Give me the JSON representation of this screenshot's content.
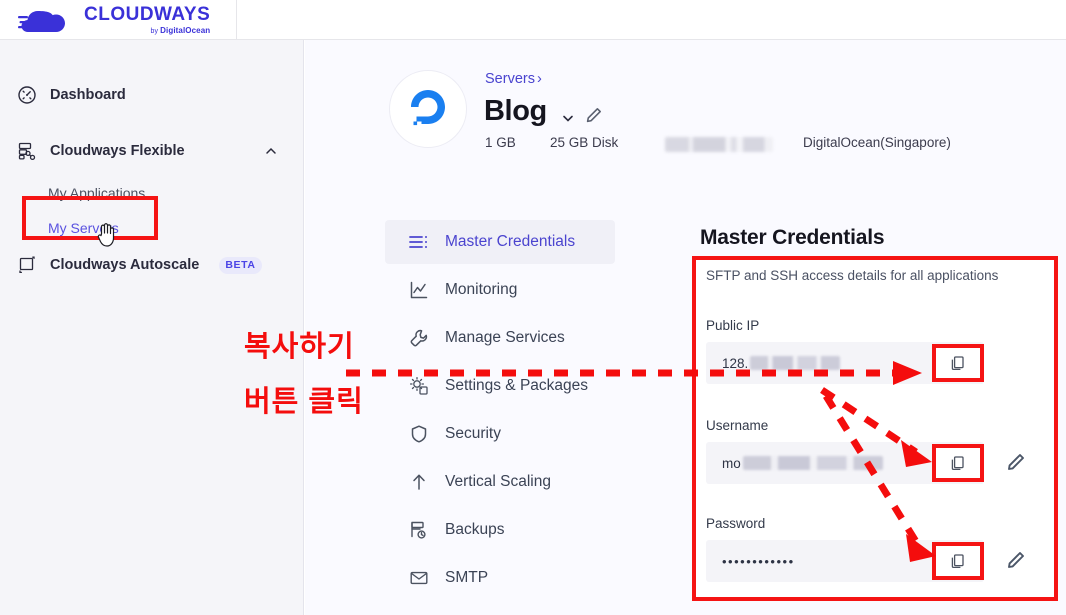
{
  "brand": {
    "name": "CLOUDWAYS",
    "byline_prefix": "by ",
    "byline": "DigitalOcean",
    "accent": "#3a31d8"
  },
  "sidebar": {
    "items": [
      {
        "label": "Dashboard",
        "icon": "speedometer-icon",
        "type": "item"
      },
      {
        "label": "Cloudways Flexible",
        "icon": "server-stack-icon",
        "type": "item",
        "expanded": true
      },
      {
        "label": "My Applications",
        "icon": "",
        "type": "sub"
      },
      {
        "label": "My Servers",
        "icon": "",
        "type": "sub",
        "selected": true
      },
      {
        "label": "Cloudways Autoscale",
        "icon": "autoscale-icon",
        "type": "item",
        "badge": "BETA"
      }
    ]
  },
  "header": {
    "breadcrumb": "Servers",
    "breadcrumb_sep": "›",
    "title": "Blog",
    "provider_logo": "digitalocean-icon",
    "meta": {
      "ram": "1 GB",
      "disk": "25 GB Disk",
      "ip_masked": "",
      "provider": "DigitalOcean(Singapore)"
    }
  },
  "server_nav": {
    "items": [
      {
        "label": "Master Credentials",
        "icon": "list-icon",
        "active": true
      },
      {
        "label": "Monitoring",
        "icon": "chart-line-icon",
        "active": false
      },
      {
        "label": "Manage Services",
        "icon": "wrench-icon",
        "active": false
      },
      {
        "label": "Settings & Packages",
        "icon": "gear-puzzle-icon",
        "active": false
      },
      {
        "label": "Security",
        "icon": "shield-icon",
        "active": false
      },
      {
        "label": "Vertical Scaling",
        "icon": "arrow-up-icon",
        "active": false
      },
      {
        "label": "Backups",
        "icon": "backup-icon",
        "active": false
      },
      {
        "label": "SMTP",
        "icon": "envelope-icon",
        "active": false
      }
    ]
  },
  "credentials": {
    "title": "Master Credentials",
    "subtitle": "SFTP and SSH access details for all applications",
    "fields": [
      {
        "label": "Public IP",
        "value": "128.",
        "masked": true,
        "has_edit": false,
        "copy_icon": "copy-icon"
      },
      {
        "label": "Username",
        "value": "mo",
        "masked": true,
        "has_edit": true,
        "copy_icon": "copy-icon",
        "edit_icon": "pencil-icon"
      },
      {
        "label": "Password",
        "value": "••••••••••••",
        "masked": false,
        "has_edit": true,
        "copy_icon": "copy-icon",
        "edit_icon": "pencil-icon"
      }
    ]
  },
  "annotations": {
    "color": "#f40d0d",
    "line1": "복사하기",
    "line2": "버튼 클릭"
  }
}
